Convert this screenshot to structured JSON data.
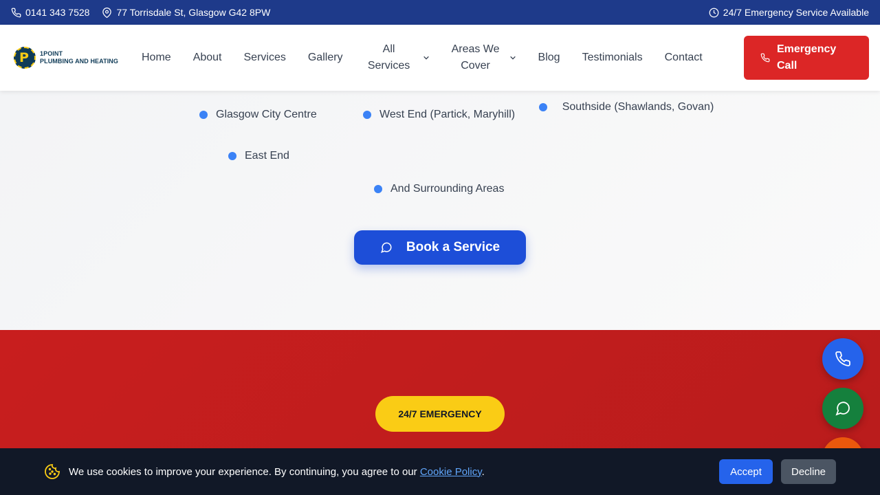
{
  "topbar": {
    "phone": "0141 343 7528",
    "address": "77 Torrisdale St, Glasgow G42 8PW",
    "hours": "24/7 Emergency Service Available"
  },
  "header": {
    "logo_line1": "1POINT",
    "logo_line2": "PLUMBING AND HEATING",
    "nav": {
      "home": "Home",
      "about": "About",
      "services": "Services",
      "gallery": "Gallery",
      "all_services": "All Services",
      "areas": "Areas We Cover",
      "blog": "Blog",
      "testimonials": "Testimonials",
      "contact": "Contact"
    },
    "emergency_call": "Emergency Call"
  },
  "areas": {
    "items": [
      "Glasgow City Centre",
      "West End (Partick, Maryhill)",
      "Southside (Shawlands, Govan)",
      "East End",
      "And Surrounding Areas"
    ]
  },
  "cta": {
    "book": "Book a Service"
  },
  "emergency": {
    "badge": "24/7 EMERGENCY"
  },
  "cookie": {
    "message": "We use cookies to improve your experience. By continuing, you agree to our ",
    "link": "Cookie Policy",
    "suffix": ".",
    "accept": "Accept",
    "decline": "Decline"
  },
  "icons": {
    "phone": "phone-icon",
    "location": "map-pin-icon",
    "clock": "clock-icon",
    "chat": "chat-bubble-icon",
    "chevron": "chevron-down-icon",
    "cookie": "cookie-icon"
  },
  "colors": {
    "topbar": "#1e3a8a",
    "emergency_red": "#dc2626",
    "primary_blue": "#1d4ed8",
    "yellow": "#facc15",
    "whatsapp_green": "#15803d",
    "cookie_bg": "#111827"
  }
}
